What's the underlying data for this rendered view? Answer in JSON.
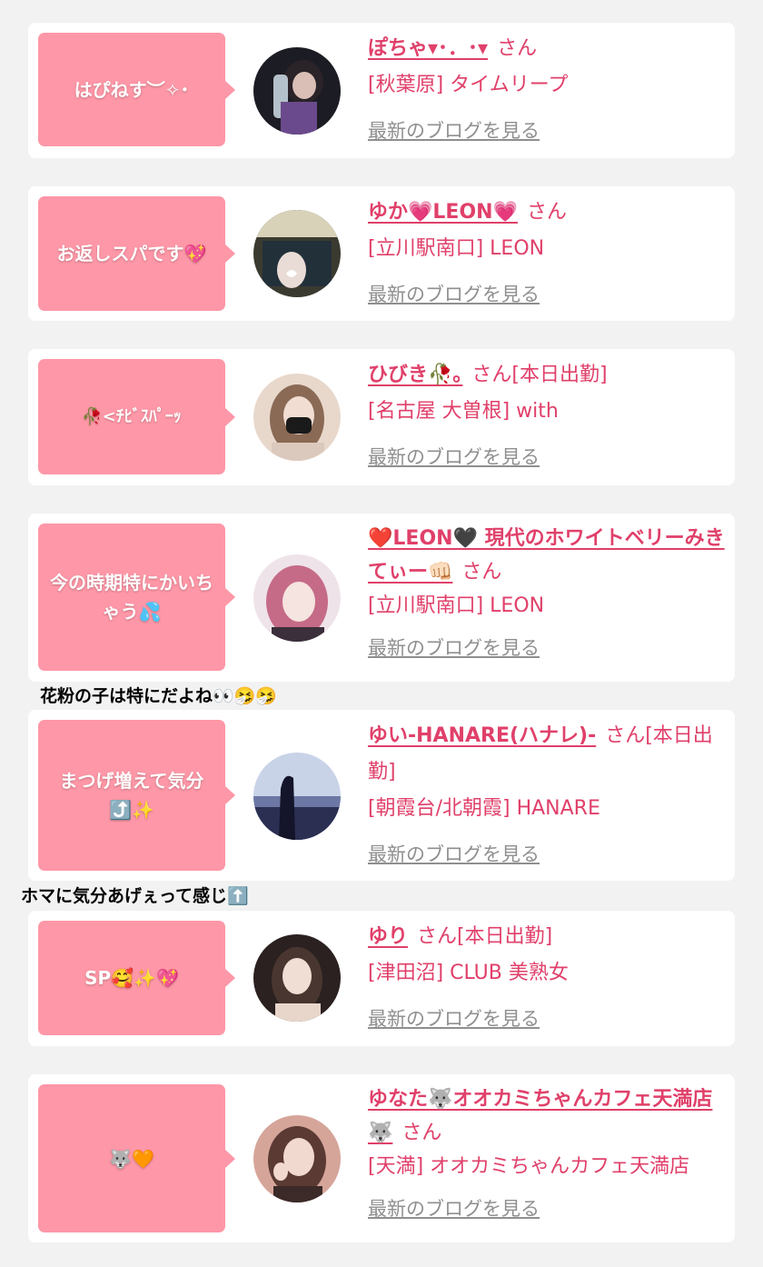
{
  "cards": [
    {
      "bubble_text": "はぴねす︶✧･",
      "name": "ぽちゃ▾･．･▾",
      "san": "さん",
      "shop": "[秋葉原] タイムリープ",
      "blog_link": "最新のブログを見る",
      "avatar": "avatar-photo-1"
    },
    {
      "bubble_text": "お返しスパです💖",
      "name": "ゆか💗LEON💗",
      "san": "さん",
      "shop": "[立川駅南口] LEON",
      "blog_link": "最新のブログを見る",
      "avatar": "avatar-photo-2"
    },
    {
      "bubble_text": "🥀<ﾁﾋﾞｽﾊﾟｰｯ",
      "name": "ひびき🥀｡",
      "san": "さん[本日出勤]",
      "shop": "[名古屋 大曽根] with",
      "blog_link": "最新のブログを見る",
      "avatar": "avatar-photo-3"
    },
    {
      "bubble_text": "今の時期特にかいちゃう💦",
      "name": "❤️LEON🖤 現代のホワイトベリーみきてぃー👊🏻",
      "san": "さん",
      "shop": "[立川駅南口] LEON",
      "blog_link": "最新のブログを見る",
      "avatar": "avatar-photo-4"
    },
    {
      "bubble_text": "まつげ増えて気分⤴️✨",
      "name": "ゆい-HANARE(ハナレ)-",
      "san": "さん[本日出勤]",
      "shop": "[朝霞台/北朝霞] HANARE",
      "blog_link": "最新のブログを見る",
      "avatar": "avatar-photo-5"
    },
    {
      "bubble_text": "SP🥰✨💖",
      "name": "ゆり",
      "san": "さん[本日出勤]",
      "shop": "[津田沼] CLUB 美熟女",
      "blog_link": "最新のブログを見る",
      "avatar": "avatar-photo-6"
    },
    {
      "bubble_text": "🐺🧡",
      "name": "ゆなた🐺オオカミちゃんカフェ天満店🐺",
      "san": "さん",
      "shop": "[天満] オオカミちゃんカフェ天満店",
      "blog_link": "最新のブログを見る",
      "avatar": "avatar-photo-7"
    }
  ],
  "comments": [
    "花粉の子は特にだよね👀🤧🤧",
    "ホマに気分あげぇって感じ⬆️"
  ],
  "colors": {
    "background": "#f2f2f2",
    "bubble": "#fe97a7",
    "name_pink": "#e0406a",
    "link_gray": "#8f8f8f"
  }
}
